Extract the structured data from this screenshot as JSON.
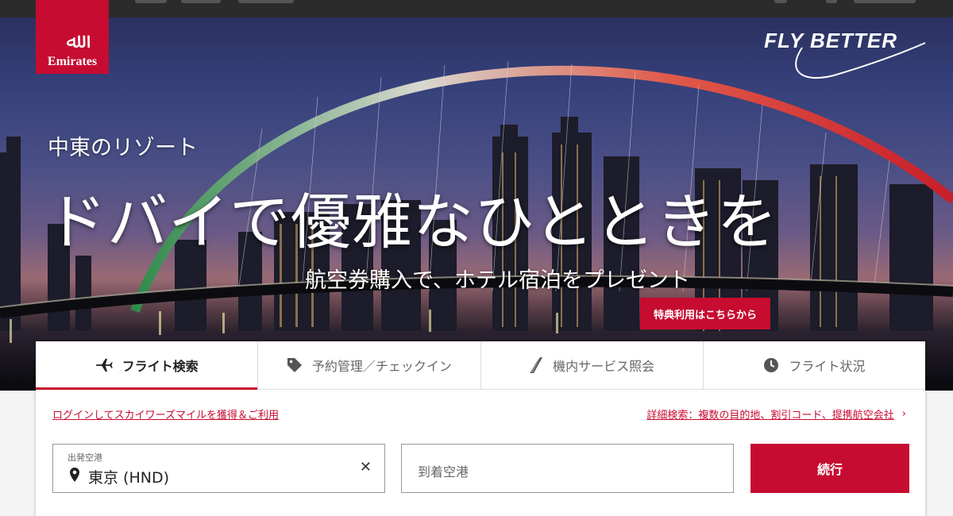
{
  "brand": {
    "logo_text": "Emirates",
    "slogan": "FLY BETTER",
    "accent_color": "#c60c30"
  },
  "hero": {
    "subtitle": "中東のリゾート",
    "title": "ドバイで優雅なひとときを",
    "lead": "航空券購入で、ホテル宿泊をプレゼント",
    "promo_button": "特典利用はこちらから"
  },
  "booking": {
    "tabs": [
      {
        "label": "フライト検索",
        "icon": "airplane-icon",
        "active": true
      },
      {
        "label": "予約管理／チェックイン",
        "icon": "tag-icon",
        "active": false
      },
      {
        "label": "機内サービス照会",
        "icon": "seat-icon",
        "active": false
      },
      {
        "label": "フライト状況",
        "icon": "clock-icon",
        "active": false
      }
    ],
    "login_link": "ログインしてスカイワーズマイルを獲得＆ご利用",
    "advanced_link": "詳細検索：複数の目的地、割引コード、提携航空会社",
    "from": {
      "label": "出発空港",
      "value": "東京 (HND)"
    },
    "to": {
      "placeholder": "到着空港"
    },
    "continue_button": "続行"
  }
}
